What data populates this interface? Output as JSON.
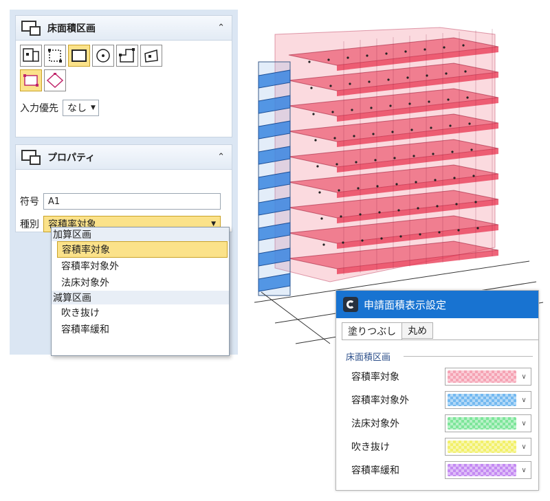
{
  "floor_panel": {
    "title": "床面積区画",
    "collapse_glyph": "⌃",
    "tools_row1": [
      "point-area-icon",
      "dashed-rect-icon",
      "rect-icon",
      "circle-icon",
      "polygon-icon",
      "rotated-rect-icon"
    ],
    "tools_row2": [
      "rect-corner-icon",
      "diamond-icon"
    ],
    "priority_label": "入力優先",
    "priority_value": "なし"
  },
  "property_panel": {
    "title": "プロパティ",
    "collapse_glyph": "⌃",
    "code_label": "符号",
    "code_value": "A1",
    "type_label": "種別",
    "type_value": "容積率対象"
  },
  "type_dropdown": {
    "group1": "加算区画",
    "items1": [
      "容積率対象",
      "容積率対象外",
      "法床対象外"
    ],
    "group2": "減算区画",
    "items2": [
      "吹き抜け",
      "容積率緩和"
    ]
  },
  "dialog": {
    "title": "申請面積表示設定",
    "tab_fill": "塗りつぶし",
    "tab_round": "丸め",
    "group": "床面積区画",
    "rows": [
      {
        "label": "容積率対象",
        "color": "#f5a3b4"
      },
      {
        "label": "容積率対象外",
        "color": "#74b9f0"
      },
      {
        "label": "法床対象外",
        "color": "#7ee69a"
      },
      {
        "label": "吹き抜け",
        "color": "#f2f06a"
      },
      {
        "label": "容積率緩和",
        "color": "#c48af2"
      }
    ]
  },
  "viewport": {
    "fill_colors": {
      "target": "#e8334f",
      "excluded": "#3a86e0"
    }
  }
}
